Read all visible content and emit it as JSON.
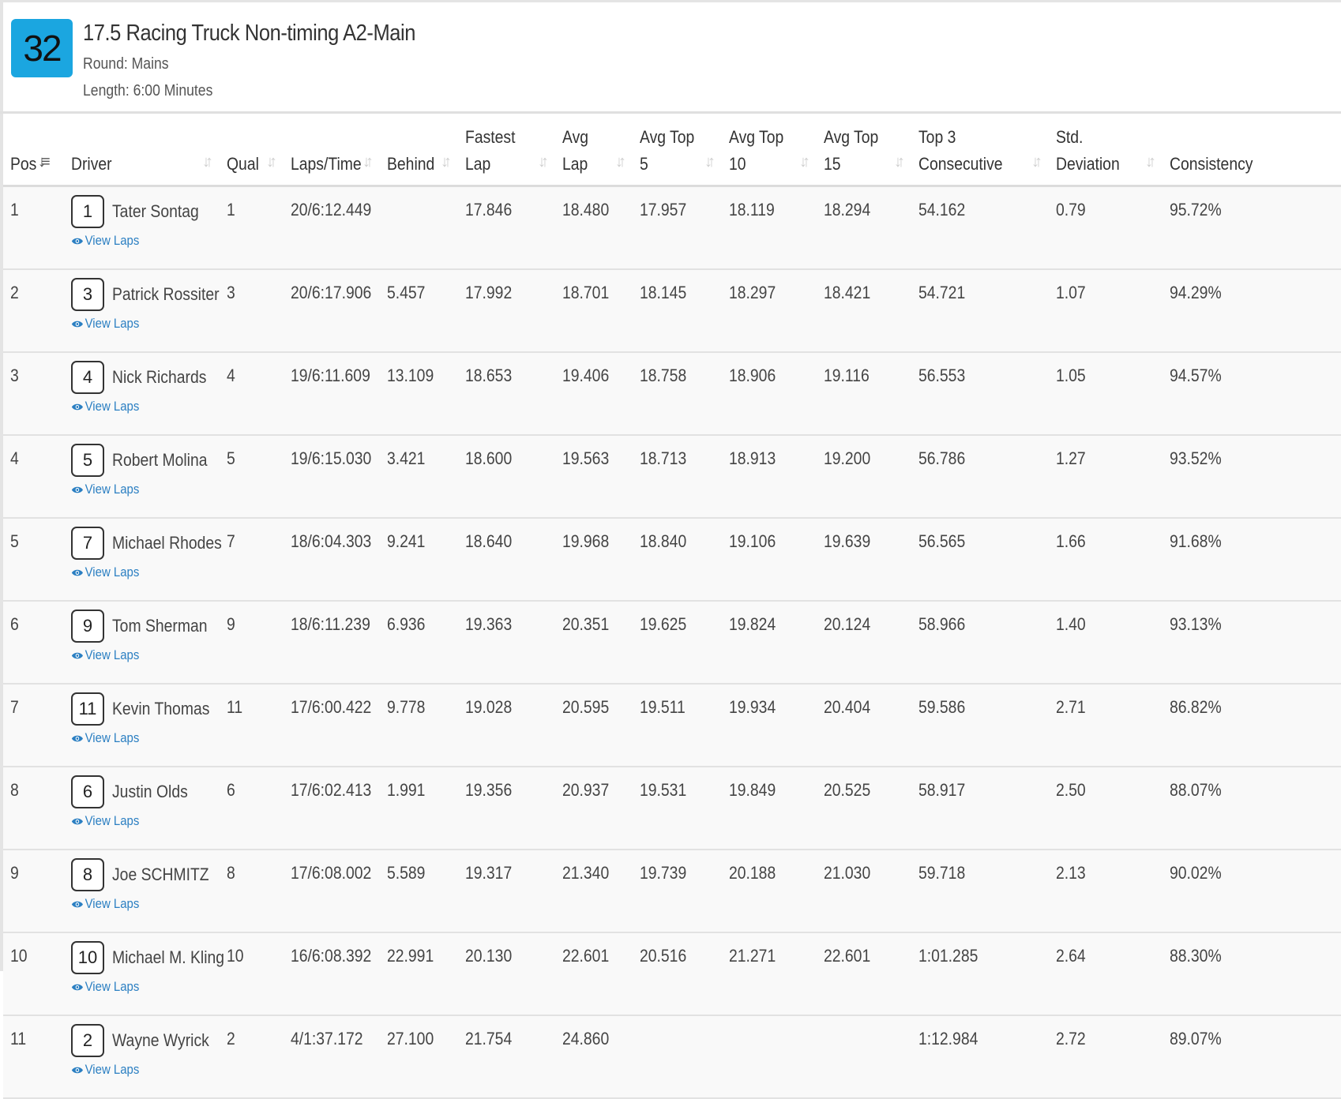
{
  "race": {
    "number": "32",
    "title": "17.5 Racing Truck Non-timing A2-Main",
    "round": "Round: Mains",
    "length": "Length: 6:00 Minutes"
  },
  "columns": [
    {
      "key": "pos",
      "label": "Pos",
      "sorted": true
    },
    {
      "key": "driver",
      "label": "Driver"
    },
    {
      "key": "qual",
      "label": "Qual"
    },
    {
      "key": "laps",
      "label": "Laps/Time"
    },
    {
      "key": "behind",
      "label": "Behind"
    },
    {
      "key": "fastest",
      "label": "Fastest\nLap"
    },
    {
      "key": "avg",
      "label": "Avg\nLap"
    },
    {
      "key": "top5",
      "label": "Avg Top\n5"
    },
    {
      "key": "top10",
      "label": "Avg Top\n10"
    },
    {
      "key": "top15",
      "label": "Avg Top\n15"
    },
    {
      "key": "top3c",
      "label": "Top 3\nConsecutive"
    },
    {
      "key": "std",
      "label": "Std.\nDeviation"
    },
    {
      "key": "consistency",
      "label": "Consistency"
    }
  ],
  "view_laps_label": "View Laps",
  "rows": [
    {
      "pos": "1",
      "car": "1",
      "driver": "Tater Sontag",
      "qual": "1",
      "laps": "20/6:12.449",
      "behind": "",
      "fastest": "17.846",
      "avg": "18.480",
      "top5": "17.957",
      "top10": "18.119",
      "top15": "18.294",
      "top3c": "54.162",
      "std": "0.79",
      "consistency": "95.72%"
    },
    {
      "pos": "2",
      "car": "3",
      "driver": "Patrick Rossiter",
      "qual": "3",
      "laps": "20/6:17.906",
      "behind": "5.457",
      "fastest": "17.992",
      "avg": "18.701",
      "top5": "18.145",
      "top10": "18.297",
      "top15": "18.421",
      "top3c": "54.721",
      "std": "1.07",
      "consistency": "94.29%"
    },
    {
      "pos": "3",
      "car": "4",
      "driver": "Nick Richards",
      "qual": "4",
      "laps": "19/6:11.609",
      "behind": "13.109",
      "fastest": "18.653",
      "avg": "19.406",
      "top5": "18.758",
      "top10": "18.906",
      "top15": "19.116",
      "top3c": "56.553",
      "std": "1.05",
      "consistency": "94.57%"
    },
    {
      "pos": "4",
      "car": "5",
      "driver": "Robert Molina",
      "qual": "5",
      "laps": "19/6:15.030",
      "behind": "3.421",
      "fastest": "18.600",
      "avg": "19.563",
      "top5": "18.713",
      "top10": "18.913",
      "top15": "19.200",
      "top3c": "56.786",
      "std": "1.27",
      "consistency": "93.52%"
    },
    {
      "pos": "5",
      "car": "7",
      "driver": "Michael Rhodes",
      "qual": "7",
      "laps": "18/6:04.303",
      "behind": "9.241",
      "fastest": "18.640",
      "avg": "19.968",
      "top5": "18.840",
      "top10": "19.106",
      "top15": "19.639",
      "top3c": "56.565",
      "std": "1.66",
      "consistency": "91.68%"
    },
    {
      "pos": "6",
      "car": "9",
      "driver": "Tom Sherman",
      "qual": "9",
      "laps": "18/6:11.239",
      "behind": "6.936",
      "fastest": "19.363",
      "avg": "20.351",
      "top5": "19.625",
      "top10": "19.824",
      "top15": "20.124",
      "top3c": "58.966",
      "std": "1.40",
      "consistency": "93.13%"
    },
    {
      "pos": "7",
      "car": "11",
      "driver": "Kevin Thomas",
      "qual": "11",
      "laps": "17/6:00.422",
      "behind": "9.778",
      "fastest": "19.028",
      "avg": "20.595",
      "top5": "19.511",
      "top10": "19.934",
      "top15": "20.404",
      "top3c": "59.586",
      "std": "2.71",
      "consistency": "86.82%"
    },
    {
      "pos": "8",
      "car": "6",
      "driver": "Justin Olds",
      "qual": "6",
      "laps": "17/6:02.413",
      "behind": "1.991",
      "fastest": "19.356",
      "avg": "20.937",
      "top5": "19.531",
      "top10": "19.849",
      "top15": "20.525",
      "top3c": "58.917",
      "std": "2.50",
      "consistency": "88.07%"
    },
    {
      "pos": "9",
      "car": "8",
      "driver": "Joe SCHMITZ",
      "qual": "8",
      "laps": "17/6:08.002",
      "behind": "5.589",
      "fastest": "19.317",
      "avg": "21.340",
      "top5": "19.739",
      "top10": "20.188",
      "top15": "21.030",
      "top3c": "59.718",
      "std": "2.13",
      "consistency": "90.02%"
    },
    {
      "pos": "10",
      "car": "10",
      "driver": "Michael M. Kling",
      "qual": "10",
      "laps": "16/6:08.392",
      "behind": "22.991",
      "fastest": "20.130",
      "avg": "22.601",
      "top5": "20.516",
      "top10": "21.271",
      "top15": "22.601",
      "top3c": "1:01.285",
      "std": "2.64",
      "consistency": "88.30%"
    },
    {
      "pos": "11",
      "car": "2",
      "driver": "Wayne Wyrick",
      "qual": "2",
      "laps": "4/1:37.172",
      "behind": "27.100",
      "fastest": "21.754",
      "avg": "24.860",
      "top5": "",
      "top10": "",
      "top15": "",
      "top3c": "1:12.984",
      "std": "2.72",
      "consistency": "89.07%"
    }
  ]
}
